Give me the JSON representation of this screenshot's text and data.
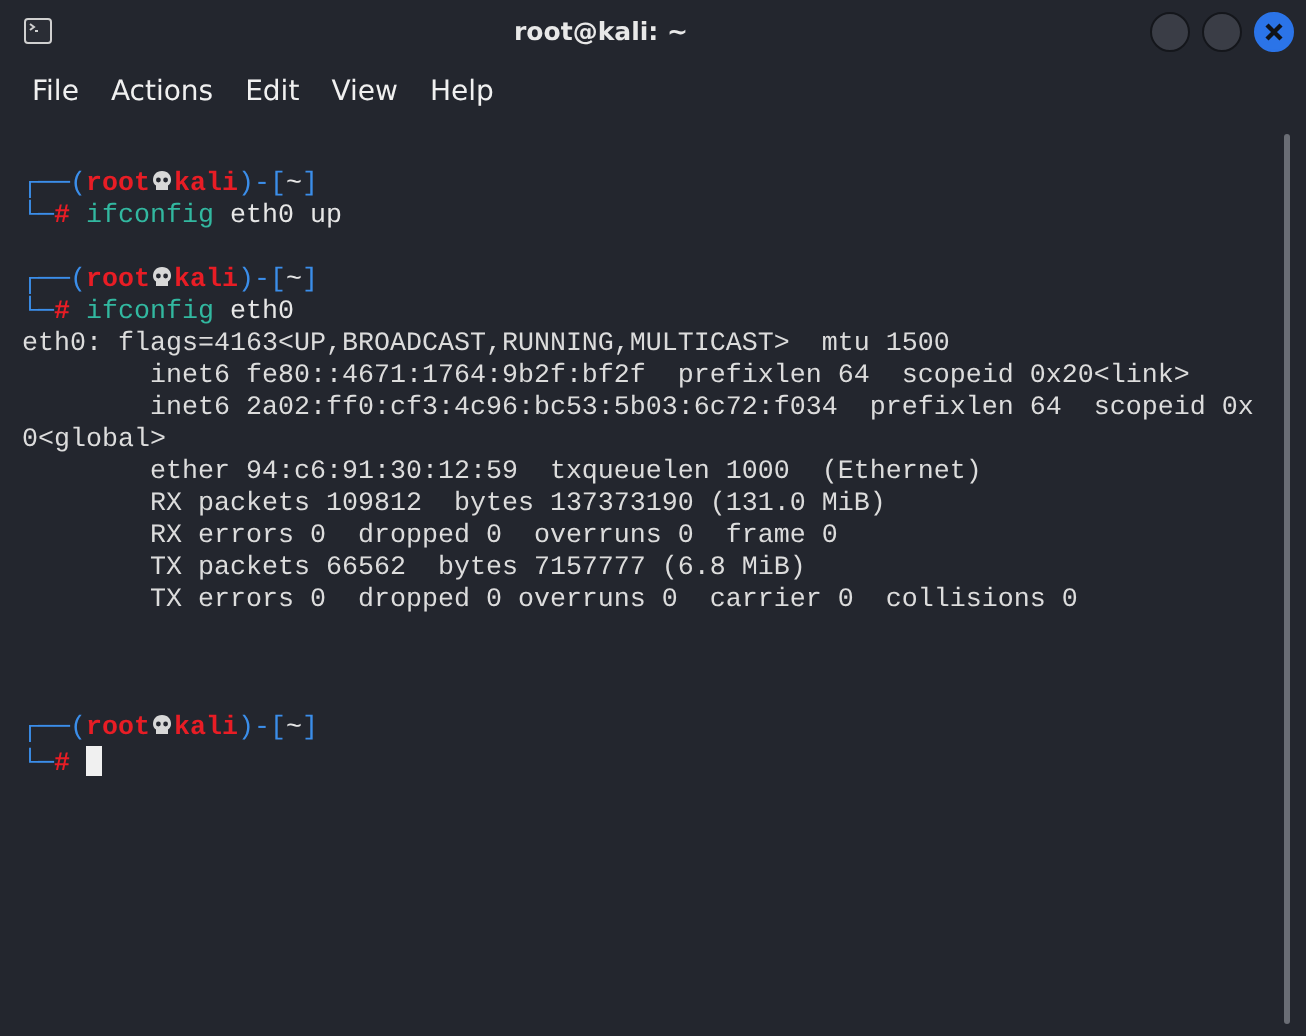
{
  "window": {
    "title": "root@kali: ~"
  },
  "menu": [
    "File",
    "Actions",
    "Edit",
    "View",
    "Help"
  ],
  "terminal": {
    "blocks": [
      {
        "prompt": {
          "open": "┌──(",
          "user": "root",
          "host": "kali",
          "sep": ")-[",
          "dir": "~",
          "close": "]",
          "corner": "└─",
          "symbol": "#"
        },
        "command": "ifconfig",
        "args": "eth0 up",
        "cursor": false
      },
      {
        "prompt": {
          "open": "┌──(",
          "user": "root",
          "host": "kali",
          "sep": ")-[",
          "dir": "~",
          "close": "]",
          "corner": "└─",
          "symbol": "#"
        },
        "command": "ifconfig",
        "args": "eth0",
        "output": [
          "eth0: flags=4163<UP,BROADCAST,RUNNING,MULTICAST>  mtu 1500",
          "        inet6 fe80::4671:1764:9b2f:bf2f  prefixlen 64  scopeid 0x20<link>",
          "        inet6 2a02:ff0:cf3:4c96:bc53:5b03:6c72:f034  prefixlen 64  scopeid 0x",
          "0<global>",
          "        ether 94:c6:91:30:12:59  txqueuelen 1000  (Ethernet)",
          "        RX packets 109812  bytes 137373190 (131.0 MiB)",
          "        RX errors 0  dropped 0  overruns 0  frame 0",
          "        TX packets 66562  bytes 7157777 (6.8 MiB)",
          "        TX errors 0  dropped 0 overruns 0  carrier 0  collisions 0"
        ],
        "cursor": false
      },
      {
        "prompt": {
          "open": "┌──(",
          "user": "root",
          "host": "kali",
          "sep": ")-[",
          "dir": "~",
          "close": "]",
          "corner": "└─",
          "symbol": "#"
        },
        "cursor": true
      }
    ]
  }
}
